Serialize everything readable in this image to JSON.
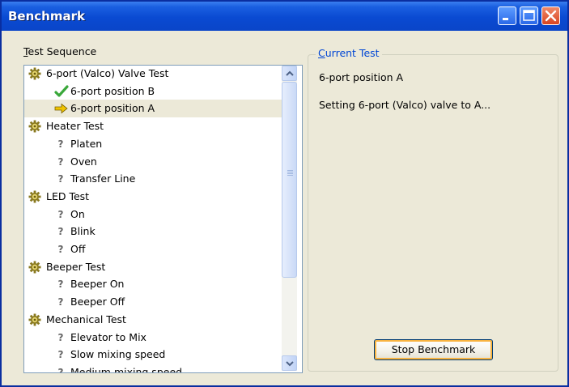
{
  "window": {
    "title": "Benchmark"
  },
  "test_sequence": {
    "label": "Test Sequence",
    "items": [
      {
        "label": "6-port (Valco) Valve Test",
        "icon": "gear-icon",
        "level": 0
      },
      {
        "label": "6-port position B",
        "icon": "checkmark-icon",
        "level": 1
      },
      {
        "label": "6-port position A",
        "icon": "arrow-right-icon",
        "level": 1,
        "selected": true
      },
      {
        "label": "Heater Test",
        "icon": "gear-icon",
        "level": 0
      },
      {
        "label": "Platen",
        "icon": "question-icon",
        "level": 1
      },
      {
        "label": "Oven",
        "icon": "question-icon",
        "level": 1
      },
      {
        "label": "Transfer Line",
        "icon": "question-icon",
        "level": 1
      },
      {
        "label": "LED Test",
        "icon": "gear-icon",
        "level": 0
      },
      {
        "label": "On",
        "icon": "question-icon",
        "level": 1
      },
      {
        "label": "Blink",
        "icon": "question-icon",
        "level": 1
      },
      {
        "label": "Off",
        "icon": "question-icon",
        "level": 1
      },
      {
        "label": "Beeper Test",
        "icon": "gear-icon",
        "level": 0
      },
      {
        "label": "Beeper On",
        "icon": "question-icon",
        "level": 1
      },
      {
        "label": "Beeper Off",
        "icon": "question-icon",
        "level": 1
      },
      {
        "label": "Mechanical Test",
        "icon": "gear-icon",
        "level": 0
      },
      {
        "label": "Elevator to Mix",
        "icon": "question-icon",
        "level": 1
      },
      {
        "label": "Slow mixing speed",
        "icon": "question-icon",
        "level": 1
      },
      {
        "label": "Medium mixing speed",
        "icon": "question-icon",
        "level": 1
      }
    ]
  },
  "current_test": {
    "caption": "Current Test",
    "name": "6-port position A",
    "status": "Setting 6-port (Valco) valve to A..."
  },
  "buttons": {
    "stop": "Stop Benchmark"
  },
  "colors": {
    "title_bar": "#0a4ad2",
    "caption": "#0046d5",
    "check": "#3aa83a",
    "arrow": "#f0c400",
    "gear": "#8a7a20"
  }
}
